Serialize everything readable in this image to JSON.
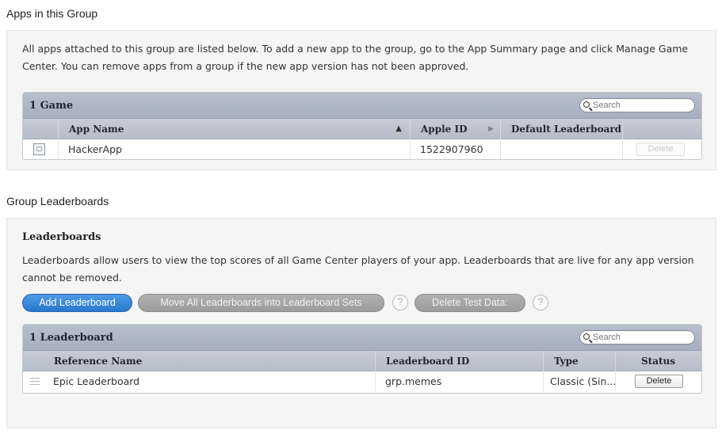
{
  "apps_section": {
    "title": "Apps in this Group",
    "description": "All apps attached to this group are listed below. To add a new app to the group, go to the App Summary page and click Manage Game Center. You can remove apps from a group if the new app version has not been approved.",
    "table": {
      "title": "1 Game",
      "search_placeholder": "Search",
      "columns": [
        "App Name",
        "Apple ID",
        "Default Leaderboard"
      ],
      "rows": [
        {
          "app_name": "HackerApp",
          "apple_id": "1522907960",
          "default_leaderboard": "",
          "action": "Delete",
          "icon": "app-placeholder-icon"
        }
      ]
    }
  },
  "leaderboards_section": {
    "title": "Group Leaderboards",
    "subtitle": "Leaderboards",
    "description": "Leaderboards allow users to view the top scores of all Game Center players of your app. Leaderboards that are live for any app version cannot be removed.",
    "buttons": {
      "add": "Add Leaderboard",
      "move": "Move All Leaderboards into Leaderboard Sets",
      "delete_test": "Delete Test Data:",
      "help": "?"
    },
    "table": {
      "title": "1 Leaderboard",
      "search_placeholder": "Search",
      "columns": [
        "Reference Name",
        "Leaderboard ID",
        "Type",
        "Status"
      ],
      "rows": [
        {
          "reference_name": "Epic Leaderboard",
          "leaderboard_id": "grp.memes",
          "type": "Classic (Sin...",
          "action": "Delete",
          "icon": "drag-handle-icon"
        }
      ]
    }
  },
  "colors": {
    "primary_button": "#2a78cd",
    "secondary_button": "#9c9c9c",
    "table_header": "#b6bdc9",
    "panel_bg": "#f5f5f5"
  }
}
